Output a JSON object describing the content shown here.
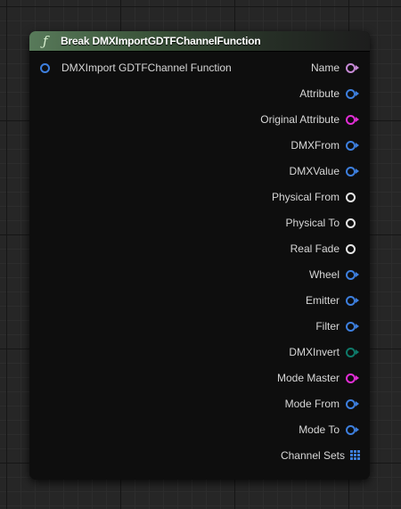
{
  "node": {
    "title": "Break DMXImportGDTFChannelFunction",
    "function_icon": "function-icon",
    "header_color": "#587a5a"
  },
  "input_pin": {
    "label": "DMXImport GDTFChannel Function",
    "type": "struct",
    "color": "#3d7fde",
    "arrow": false
  },
  "output_pins": [
    {
      "label": "Name",
      "type": "name",
      "color": "#c78ad6",
      "arrow": true
    },
    {
      "label": "Attribute",
      "type": "struct",
      "color": "#3d7fde",
      "arrow": true
    },
    {
      "label": "Original Attribute",
      "type": "string",
      "color": "#e22ed6",
      "arrow": true
    },
    {
      "label": "DMXFrom",
      "type": "struct",
      "color": "#3d7fde",
      "arrow": true
    },
    {
      "label": "DMXValue",
      "type": "struct",
      "color": "#3d7fde",
      "arrow": true
    },
    {
      "label": "Physical From",
      "type": "float",
      "color": "#e6e6e6",
      "arrow": false
    },
    {
      "label": "Physical To",
      "type": "float",
      "color": "#e6e6e6",
      "arrow": false
    },
    {
      "label": "Real Fade",
      "type": "float",
      "color": "#e6e6e6",
      "arrow": false
    },
    {
      "label": "Wheel",
      "type": "struct",
      "color": "#3d7fde",
      "arrow": true
    },
    {
      "label": "Emitter",
      "type": "struct",
      "color": "#3d7fde",
      "arrow": true
    },
    {
      "label": "Filter",
      "type": "struct",
      "color": "#3d7fde",
      "arrow": true
    },
    {
      "label": "DMXInvert",
      "type": "enum",
      "color": "#0e7a6a",
      "arrow": true
    },
    {
      "label": "Mode Master",
      "type": "string",
      "color": "#e22ed6",
      "arrow": true
    },
    {
      "label": "Mode From",
      "type": "struct",
      "color": "#3d7fde",
      "arrow": true
    },
    {
      "label": "Mode To",
      "type": "struct",
      "color": "#3d7fde",
      "arrow": true
    },
    {
      "label": "Channel Sets",
      "type": "array",
      "color": "#3d7fde",
      "arrow": false
    }
  ]
}
